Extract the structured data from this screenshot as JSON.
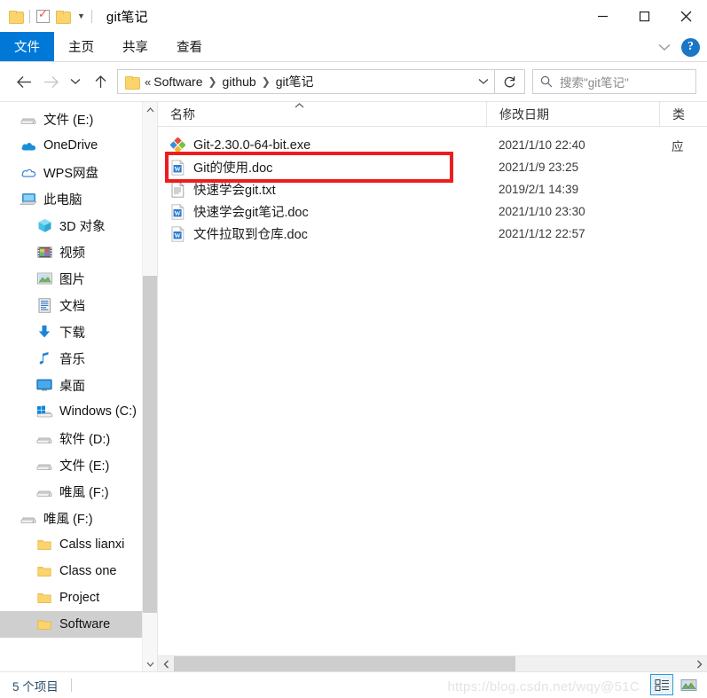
{
  "window": {
    "title": "git笔记",
    "quick_access": [
      "folder-icon",
      "properties-icon",
      "new-folder-icon",
      "customize-caret"
    ],
    "controls": {
      "minimize": "minimize-icon",
      "maximize": "maximize-icon",
      "close": "close-icon"
    }
  },
  "ribbon": {
    "tabs": [
      {
        "label": "文件",
        "active": true
      },
      {
        "label": "主页",
        "active": false
      },
      {
        "label": "共享",
        "active": false
      },
      {
        "label": "查看",
        "active": false
      }
    ],
    "expand_icon": "chevron-down-icon",
    "help_label": "?"
  },
  "address": {
    "back": "back-arrow-icon",
    "forward": "forward-arrow-icon",
    "recent": "chevron-down-icon",
    "up": "up-arrow-icon",
    "overflow": "«",
    "crumbs": [
      "Software",
      "github",
      "git笔记"
    ],
    "dropdown": "chevron-down-icon",
    "refresh": "refresh-icon"
  },
  "search": {
    "icon": "search-icon",
    "placeholder": "搜索\"git笔记\""
  },
  "sidebar": {
    "items": [
      {
        "label": "文件 (E:)",
        "icon": "drive-icon",
        "indent": 1,
        "selected": false
      },
      {
        "label": "OneDrive",
        "icon": "onedrive-cloud-icon",
        "indent": 1,
        "selected": false
      },
      {
        "label": "WPS网盘",
        "icon": "wps-cloud-icon",
        "indent": 1,
        "selected": false
      },
      {
        "label": "此电脑",
        "icon": "this-pc-icon",
        "indent": 1,
        "selected": false
      },
      {
        "label": "3D 对象",
        "icon": "3d-objects-icon",
        "indent": 2,
        "selected": false
      },
      {
        "label": "视频",
        "icon": "videos-icon",
        "indent": 2,
        "selected": false
      },
      {
        "label": "图片",
        "icon": "pictures-icon",
        "indent": 2,
        "selected": false
      },
      {
        "label": "文档",
        "icon": "documents-icon",
        "indent": 2,
        "selected": false
      },
      {
        "label": "下载",
        "icon": "downloads-icon",
        "indent": 2,
        "selected": false
      },
      {
        "label": "音乐",
        "icon": "music-icon",
        "indent": 2,
        "selected": false
      },
      {
        "label": "桌面",
        "icon": "desktop-icon",
        "indent": 2,
        "selected": false
      },
      {
        "label": "Windows (C:)",
        "icon": "windows-drive-icon",
        "indent": 2,
        "selected": false
      },
      {
        "label": "软件 (D:)",
        "icon": "drive-icon",
        "indent": 2,
        "selected": false
      },
      {
        "label": "文件 (E:)",
        "icon": "drive-icon",
        "indent": 2,
        "selected": false
      },
      {
        "label": "唯風 (F:)",
        "icon": "drive-icon",
        "indent": 2,
        "selected": false
      },
      {
        "label": "唯風 (F:)",
        "icon": "drive-icon",
        "indent": 1,
        "selected": false
      },
      {
        "label": "Calss lianxi",
        "icon": "folder-icon",
        "indent": 2,
        "selected": false
      },
      {
        "label": "Class one",
        "icon": "folder-icon",
        "indent": 2,
        "selected": false
      },
      {
        "label": "Project",
        "icon": "folder-icon",
        "indent": 2,
        "selected": false
      },
      {
        "label": "Software",
        "icon": "folder-icon",
        "indent": 2,
        "selected": true
      }
    ],
    "scroll_up": "scroll-up-icon",
    "scroll_down": "scroll-down-icon"
  },
  "filepane": {
    "columns": [
      "名称",
      "修改日期",
      "类"
    ],
    "sort_indicator": "sort-ascending-icon",
    "rows": [
      {
        "name": "Git-2.30.0-64-bit.exe",
        "date": "2021/1/10 22:40",
        "type": "应",
        "icon": "git-icon",
        "highlighted": true
      },
      {
        "name": "Git的使用.doc",
        "date": "2021/1/9 23:25",
        "type": "",
        "icon": "word-doc-icon",
        "highlighted": false
      },
      {
        "name": "快速学会git.txt",
        "date": "2019/2/1 14:39",
        "type": "",
        "icon": "text-file-icon",
        "highlighted": false
      },
      {
        "name": "快速学会git笔记.doc",
        "date": "2021/1/10 23:30",
        "type": "",
        "icon": "word-doc-icon",
        "highlighted": false
      },
      {
        "name": "文件拉取到仓库.doc",
        "date": "2021/1/12 22:57",
        "type": "",
        "icon": "word-doc-icon",
        "highlighted": false
      }
    ],
    "hscroll_left": "scroll-left-icon",
    "hscroll_right": "scroll-right-icon"
  },
  "status": {
    "item_count": "5 个项目",
    "views": [
      {
        "name": "details-view",
        "selected": true
      },
      {
        "name": "large-icons-view",
        "selected": false
      }
    ],
    "watermark": "https://blog.csdn.net/wqy@51C"
  },
  "colors": {
    "accent": "#0078d7",
    "highlight_red": "#ee1d1d",
    "selection_gray": "#cfcfcf"
  }
}
